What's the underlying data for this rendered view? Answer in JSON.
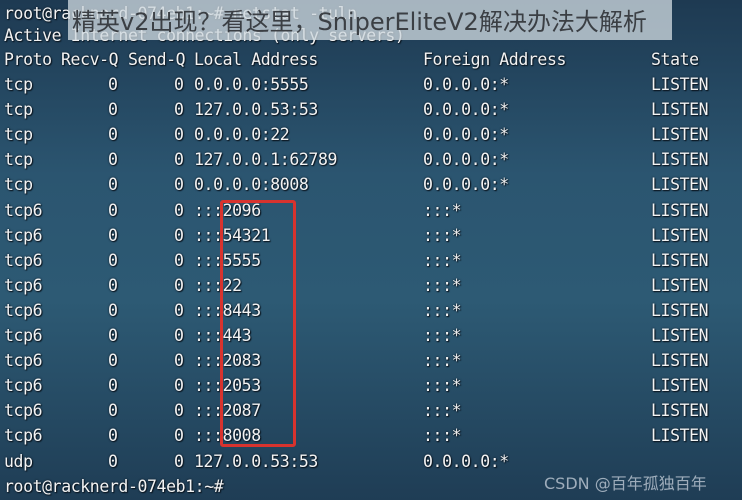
{
  "terminal": {
    "command_line": "root@racknerd-074eb1:~# netstat -tuln",
    "info_line": "Active Internet connections (only servers)",
    "headers": {
      "proto": "Proto",
      "recv_q": "Recv-Q",
      "send_q": "Send-Q",
      "local": "Local Address",
      "foreign": "Foreign Address",
      "state": "State"
    },
    "rows": [
      {
        "proto": "tcp",
        "recv": "0",
        "send": "0",
        "local": "0.0.0.0:5555",
        "foreign": "0.0.0.0:*",
        "state": "LISTEN"
      },
      {
        "proto": "tcp",
        "recv": "0",
        "send": "0",
        "local": "127.0.0.53:53",
        "foreign": "0.0.0.0:*",
        "state": "LISTEN"
      },
      {
        "proto": "tcp",
        "recv": "0",
        "send": "0",
        "local": "0.0.0.0:22",
        "foreign": "0.0.0.0:*",
        "state": "LISTEN"
      },
      {
        "proto": "tcp",
        "recv": "0",
        "send": "0",
        "local": "127.0.0.1:62789",
        "foreign": "0.0.0.0:*",
        "state": "LISTEN"
      },
      {
        "proto": "tcp",
        "recv": "0",
        "send": "0",
        "local": "0.0.0.0:8008",
        "foreign": "0.0.0.0:*",
        "state": "LISTEN"
      },
      {
        "proto": "tcp6",
        "recv": "0",
        "send": "0",
        "local": ":::2096",
        "foreign": ":::*",
        "state": "LISTEN"
      },
      {
        "proto": "tcp6",
        "recv": "0",
        "send": "0",
        "local": ":::54321",
        "foreign": ":::*",
        "state": "LISTEN"
      },
      {
        "proto": "tcp6",
        "recv": "0",
        "send": "0",
        "local": ":::5555",
        "foreign": ":::*",
        "state": "LISTEN"
      },
      {
        "proto": "tcp6",
        "recv": "0",
        "send": "0",
        "local": ":::22",
        "foreign": ":::*",
        "state": "LISTEN"
      },
      {
        "proto": "tcp6",
        "recv": "0",
        "send": "0",
        "local": ":::8443",
        "foreign": ":::*",
        "state": "LISTEN"
      },
      {
        "proto": "tcp6",
        "recv": "0",
        "send": "0",
        "local": ":::443",
        "foreign": ":::*",
        "state": "LISTEN"
      },
      {
        "proto": "tcp6",
        "recv": "0",
        "send": "0",
        "local": ":::2083",
        "foreign": ":::*",
        "state": "LISTEN"
      },
      {
        "proto": "tcp6",
        "recv": "0",
        "send": "0",
        "local": ":::2053",
        "foreign": ":::*",
        "state": "LISTEN"
      },
      {
        "proto": "tcp6",
        "recv": "0",
        "send": "0",
        "local": ":::2087",
        "foreign": ":::*",
        "state": "LISTEN"
      },
      {
        "proto": "tcp6",
        "recv": "0",
        "send": "0",
        "local": ":::8008",
        "foreign": ":::*",
        "state": "LISTEN"
      },
      {
        "proto": "udp",
        "recv": "0",
        "send": "0",
        "local": "127.0.0.53:53",
        "foreign": "0.0.0.0:*",
        "state": ""
      }
    ],
    "prompt": "root@racknerd-074eb1:~#"
  },
  "overlay": {
    "banner_text": "精英v2出现？看这里，SniperEliteV2解决办法大解析",
    "watermark": "CSDN @百年孤独百年"
  },
  "colors": {
    "background": "#2b5570",
    "text": "#f3f3f3",
    "highlight_border": "#d8332e"
  }
}
